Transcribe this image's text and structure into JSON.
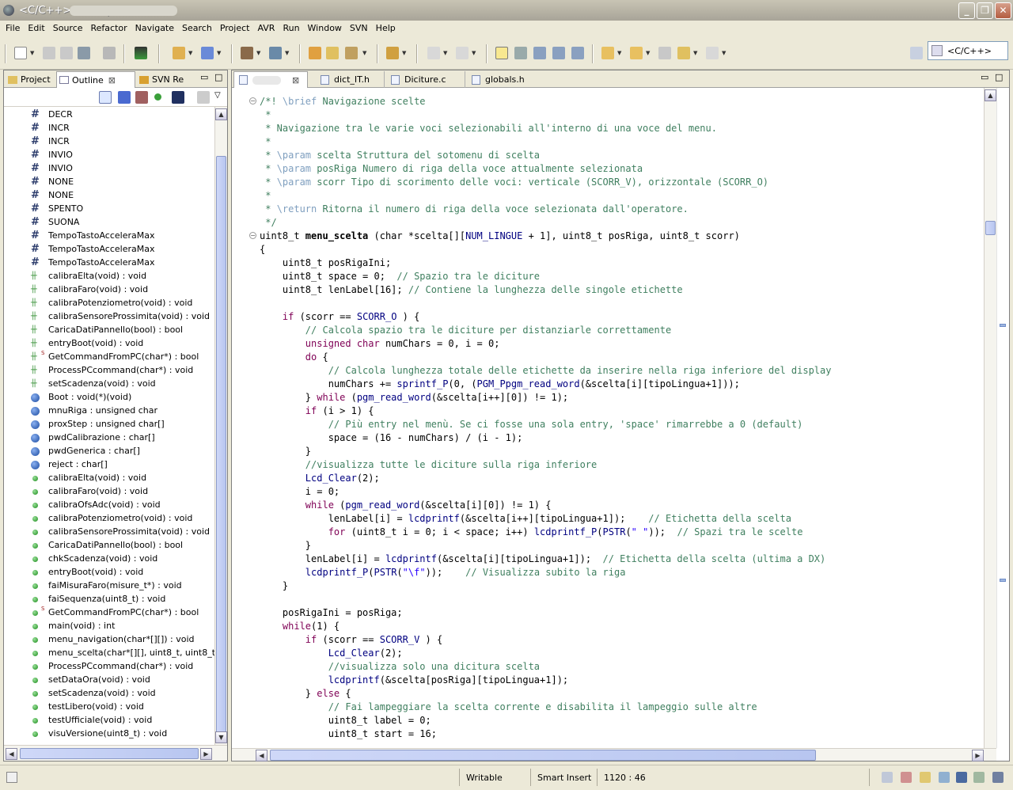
{
  "window": {
    "title": "<C/C++> -                              - Eclipse"
  },
  "menu": [
    "File",
    "Edit",
    "Source",
    "Refactor",
    "Navigate",
    "Search",
    "Project",
    "AVR",
    "Run",
    "Window",
    "SVN",
    "Help"
  ],
  "perspective": {
    "label": "<C/C++>"
  },
  "left_tabs": [
    {
      "label": "Project",
      "icon": "project-icon"
    },
    {
      "label": "Outline",
      "icon": "outline-icon",
      "close": "⊠"
    },
    {
      "label": "SVN Re",
      "icon": "svn-icon"
    }
  ],
  "outline_items": [
    {
      "label": "DECR",
      "kind": "macro"
    },
    {
      "label": "INCR",
      "kind": "macro"
    },
    {
      "label": "INCR",
      "kind": "macro"
    },
    {
      "label": "INVIO",
      "kind": "macro"
    },
    {
      "label": "INVIO",
      "kind": "macro"
    },
    {
      "label": "NONE",
      "kind": "macro"
    },
    {
      "label": "NONE",
      "kind": "macro"
    },
    {
      "label": "SPENTO",
      "kind": "macro"
    },
    {
      "label": "SUONA",
      "kind": "macro"
    },
    {
      "label": "TempoTastoAcceleraMax",
      "kind": "macro"
    },
    {
      "label": "TempoTastoAcceleraMax",
      "kind": "macro"
    },
    {
      "label": "TempoTastoAcceleraMax",
      "kind": "macro"
    },
    {
      "label": "calibraElta(void) : void",
      "kind": "decl"
    },
    {
      "label": "calibraFaro(void) : void",
      "kind": "decl"
    },
    {
      "label": "calibraPotenziometro(void) : void",
      "kind": "decl"
    },
    {
      "label": "calibraSensoreProssimita(void) : void",
      "kind": "decl"
    },
    {
      "label": "CaricaDatiPannello(bool) : bool",
      "kind": "decl"
    },
    {
      "label": "entryBoot(void) : void",
      "kind": "decl"
    },
    {
      "label": "GetCommandFromPC(char*) : bool",
      "kind": "decl-static"
    },
    {
      "label": "ProcessPCcommand(char*) : void",
      "kind": "decl"
    },
    {
      "label": "setScadenza(void) : void",
      "kind": "decl"
    },
    {
      "label": "Boot : void(*)(void)",
      "kind": "var"
    },
    {
      "label": "mnuRiga : unsigned char",
      "kind": "var"
    },
    {
      "label": "proxStep : unsigned char[]",
      "kind": "var"
    },
    {
      "label": "pwdCalibrazione : char[]",
      "kind": "var"
    },
    {
      "label": "pwdGenerica : char[]",
      "kind": "var"
    },
    {
      "label": "reject : char[]",
      "kind": "var"
    },
    {
      "label": "calibraElta(void) : void",
      "kind": "func"
    },
    {
      "label": "calibraFaro(void) : void",
      "kind": "func"
    },
    {
      "label": "calibraOfsAdc(void) : void",
      "kind": "func"
    },
    {
      "label": "calibraPotenziometro(void) : void",
      "kind": "func"
    },
    {
      "label": "calibraSensoreProssimita(void) : void",
      "kind": "func"
    },
    {
      "label": "CaricaDatiPannello(bool) : bool",
      "kind": "func"
    },
    {
      "label": "chkScadenza(void) : void",
      "kind": "func"
    },
    {
      "label": "entryBoot(void) : void",
      "kind": "func"
    },
    {
      "label": "faiMisuraFaro(misure_t*) : void",
      "kind": "func"
    },
    {
      "label": "faiSequenza(uint8_t) : void",
      "kind": "func"
    },
    {
      "label": "GetCommandFromPC(char*) : bool",
      "kind": "func-static"
    },
    {
      "label": "main(void) : int",
      "kind": "func"
    },
    {
      "label": "menu_navigation(char*[][]) : void",
      "kind": "func"
    },
    {
      "label": "menu_scelta(char*[][], uint8_t, uint8_t) : u",
      "kind": "func"
    },
    {
      "label": "ProcessPCcommand(char*) : void",
      "kind": "func"
    },
    {
      "label": "setDataOra(void) : void",
      "kind": "func"
    },
    {
      "label": "setScadenza(void) : void",
      "kind": "func"
    },
    {
      "label": "testLibero(void) : void",
      "kind": "func"
    },
    {
      "label": "testUfficiale(void) : void",
      "kind": "func"
    },
    {
      "label": "visuVersione(uint8_t) : void",
      "kind": "func"
    }
  ],
  "editor_tabs": [
    {
      "label": "",
      "active": true
    },
    {
      "label": "dict_IT.h"
    },
    {
      "label": "Diciture.c"
    },
    {
      "label": "globals.h"
    }
  ],
  "code_lines": [
    [
      [
        "cm",
        "/*! "
      ],
      [
        "tg",
        "\\brief"
      ],
      [
        "cm",
        " Navigazione scelte"
      ]
    ],
    [
      [
        "cm",
        " *"
      ]
    ],
    [
      [
        "cm",
        " * Navigazione tra le varie voci selezionabili all'interno di una voce del menu."
      ]
    ],
    [
      [
        "cm",
        " *"
      ]
    ],
    [
      [
        "cm",
        " * "
      ],
      [
        "tg",
        "\\param"
      ],
      [
        "cm",
        " scelta Struttura del sotomenu di scelta"
      ]
    ],
    [
      [
        "cm",
        " * "
      ],
      [
        "tg",
        "\\param"
      ],
      [
        "cm",
        " posRiga Numero di riga della voce attualmente selezionata"
      ]
    ],
    [
      [
        "cm",
        " * "
      ],
      [
        "tg",
        "\\param"
      ],
      [
        "cm",
        " scorr Tipo di scorimento delle voci: verticale (SCORR_V), orizzontale (SCORR_O)"
      ]
    ],
    [
      [
        "cm",
        " *"
      ]
    ],
    [
      [
        "cm",
        " * "
      ],
      [
        "tg",
        "\\return"
      ],
      [
        "cm",
        " Ritorna il numero di riga della voce selezionata dall'operatore."
      ]
    ],
    [
      [
        "cm",
        " */"
      ]
    ],
    [
      [
        "",
        "uint8_t "
      ],
      [
        "b",
        "menu_scelta"
      ],
      [
        "",
        " (char *scelta[]["
      ],
      [
        "mac",
        "NUM_LINGUE"
      ],
      [
        "",
        " + 1], uint8_t posRiga, uint8_t scorr)"
      ]
    ],
    [
      [
        "",
        "{"
      ]
    ],
    [
      [
        "",
        "    uint8_t posRigaIni;"
      ]
    ],
    [
      [
        "",
        "    uint8_t space = 0;  "
      ],
      [
        "cm",
        "// Spazio tra le diciture"
      ]
    ],
    [
      [
        "",
        "    uint8_t lenLabel[16]; "
      ],
      [
        "cm",
        "// Contiene la lunghezza delle singole etichette"
      ]
    ],
    [
      [
        "",
        ""
      ]
    ],
    [
      [
        "",
        "    "
      ],
      [
        "kw",
        "if"
      ],
      [
        "",
        " (scorr == "
      ],
      [
        "mac",
        "SCORR_O"
      ],
      [
        "",
        " ) {"
      ]
    ],
    [
      [
        "",
        "        "
      ],
      [
        "cm",
        "// Calcola spazio tra le diciture per distanziarle correttamente"
      ]
    ],
    [
      [
        "",
        "        "
      ],
      [
        "kw",
        "unsigned char"
      ],
      [
        "",
        " numChars = 0, i = 0;"
      ]
    ],
    [
      [
        "",
        "        "
      ],
      [
        "kw",
        "do"
      ],
      [
        "",
        " {"
      ]
    ],
    [
      [
        "",
        "            "
      ],
      [
        "cm",
        "// Calcola lunghezza totale delle etichette da inserire nella riga inferiore del display"
      ]
    ],
    [
      [
        "",
        "            numChars += "
      ],
      [
        "fn",
        "sprintf_P"
      ],
      [
        "",
        "(0, ("
      ],
      [
        "mac",
        "PGM_P"
      ],
      [
        ")"
      ],
      [
        "fn",
        "pgm_read_word"
      ],
      [
        "",
        "(&scelta[i][tipoLingua+1]));"
      ]
    ],
    [
      [
        "",
        "        } "
      ],
      [
        "kw",
        "while"
      ],
      [
        "",
        " ("
      ],
      [
        "fn",
        "pgm_read_word"
      ],
      [
        "",
        "(&scelta[i++][0]) != 1);"
      ]
    ],
    [
      [
        "",
        "        "
      ],
      [
        "kw",
        "if"
      ],
      [
        "",
        " (i > 1) {"
      ]
    ],
    [
      [
        "",
        "            "
      ],
      [
        "cm",
        "// Più entry nel menù. Se ci fosse una sola entry, 'space' rimarrebbe a 0 (default)"
      ]
    ],
    [
      [
        "",
        "            space = (16 - numChars) / (i - 1);"
      ]
    ],
    [
      [
        "",
        "        }"
      ]
    ],
    [
      [
        "",
        "        "
      ],
      [
        "cm",
        "//visualizza tutte le diciture sulla riga inferiore"
      ]
    ],
    [
      [
        "",
        "        "
      ],
      [
        "fn",
        "Lcd_Clear"
      ],
      [
        "",
        "(2);"
      ]
    ],
    [
      [
        "",
        "        i = 0;"
      ]
    ],
    [
      [
        "",
        "        "
      ],
      [
        "kw",
        "while"
      ],
      [
        "",
        " ("
      ],
      [
        "fn",
        "pgm_read_word"
      ],
      [
        "",
        "(&scelta[i][0]) != 1) {"
      ]
    ],
    [
      [
        "",
        "            lenLabel[i] = "
      ],
      [
        "fn",
        "lcdprintf"
      ],
      [
        "",
        "(&scelta[i++][tipoLingua+1]);    "
      ],
      [
        "cm",
        "// Etichetta della scelta"
      ]
    ],
    [
      [
        "",
        "            "
      ],
      [
        "kw",
        "for"
      ],
      [
        "",
        " (uint8_t i = 0; i < space; i++) "
      ],
      [
        "fn",
        "lcdprintf_P"
      ],
      [
        "",
        "("
      ],
      [
        "mac",
        "PSTR"
      ],
      [
        "",
        "("
      ],
      [
        "st",
        "\" \""
      ],
      [
        "",
        "));  "
      ],
      [
        "cm",
        "// Spazi tra le scelte"
      ]
    ],
    [
      [
        "",
        "        }"
      ]
    ],
    [
      [
        "",
        "        lenLabel[i] = "
      ],
      [
        "fn",
        "lcdprintf"
      ],
      [
        "",
        "(&scelta[i][tipoLingua+1]);  "
      ],
      [
        "cm",
        "// Etichetta della scelta (ultima a DX)"
      ]
    ],
    [
      [
        "",
        "        "
      ],
      [
        "fn",
        "lcdprintf_P"
      ],
      [
        "",
        "("
      ],
      [
        "mac",
        "PSTR"
      ],
      [
        "",
        "("
      ],
      [
        "st",
        "\"\\f\""
      ],
      [
        "",
        "));    "
      ],
      [
        "cm",
        "// Visualizza subito la riga"
      ]
    ],
    [
      [
        "",
        "    }"
      ]
    ],
    [
      [
        "",
        ""
      ]
    ],
    [
      [
        "",
        "    posRigaIni = posRiga;"
      ]
    ],
    [
      [
        "",
        "    "
      ],
      [
        "kw",
        "while"
      ],
      [
        "",
        "(1) {"
      ]
    ],
    [
      [
        "",
        "        "
      ],
      [
        "kw",
        "if"
      ],
      [
        "",
        " (scorr == "
      ],
      [
        "mac",
        "SCORR_V"
      ],
      [
        "",
        " ) {"
      ]
    ],
    [
      [
        "",
        "            "
      ],
      [
        "fn",
        "Lcd_Clear"
      ],
      [
        "",
        "(2);"
      ]
    ],
    [
      [
        "",
        "            "
      ],
      [
        "cm",
        "//visualizza solo una dicitura scelta"
      ]
    ],
    [
      [
        "",
        "            "
      ],
      [
        "fn",
        "lcdprintf"
      ],
      [
        "",
        "(&scelta[posRiga][tipoLingua+1]);"
      ]
    ],
    [
      [
        "",
        "        } "
      ],
      [
        "kw",
        "else"
      ],
      [
        "",
        " {"
      ]
    ],
    [
      [
        "",
        "            "
      ],
      [
        "cm",
        "// Fai lampeggiare la scelta corrente e disabilita il lampeggio sulle altre"
      ]
    ],
    [
      [
        "",
        "            uint8_t label = 0;"
      ]
    ],
    [
      [
        "",
        "            uint8_t start = 16;"
      ]
    ]
  ],
  "status": {
    "writable": "Writable",
    "insert_mode": "Smart Insert",
    "position": "1120 : 46"
  }
}
